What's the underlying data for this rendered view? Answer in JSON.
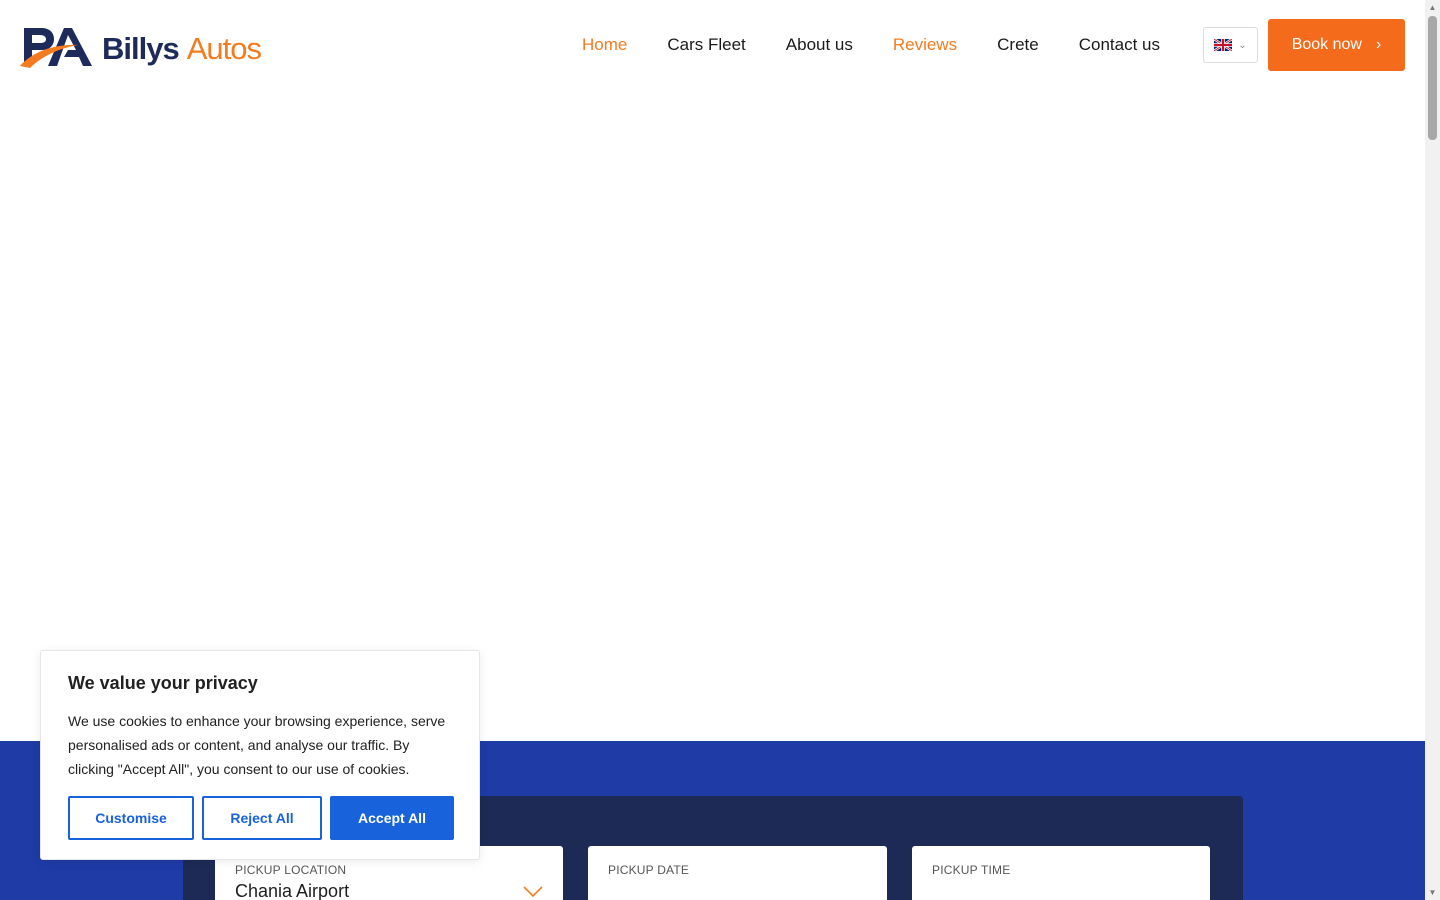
{
  "brand": {
    "name_part1": "Billys",
    "name_part2": "Autos",
    "primary_color": "#1e2a5a",
    "accent_color": "#f47b20"
  },
  "nav": {
    "items": [
      {
        "label": "Home",
        "active": true
      },
      {
        "label": "Cars Fleet",
        "active": false
      },
      {
        "label": "About us",
        "active": false
      },
      {
        "label": "Reviews",
        "active": true
      },
      {
        "label": "Crete",
        "active": false
      },
      {
        "label": "Contact us",
        "active": false
      }
    ]
  },
  "language": {
    "icon": "uk-flag-icon",
    "chevron": "⌄"
  },
  "cta": {
    "label": "Book now",
    "arrow": "›",
    "color": "#f56b1c"
  },
  "booking": {
    "band_color": "#1e3ba6",
    "panel_color": "#1c2a55",
    "pickup_location": {
      "label": "PICKUP LOCATION",
      "value": "Chania Airport"
    },
    "pickup_date": {
      "label": "PICKUP DATE",
      "value": ""
    },
    "pickup_time": {
      "label": "PICKUP TIME",
      "value": ""
    }
  },
  "cookie": {
    "title": "We value your privacy",
    "text": "We use cookies to enhance your browsing experience, serve personalised ads or content, and analyse our traffic. By clicking \"Accept All\", you consent to our use of cookies.",
    "customise_label": "Customise",
    "reject_label": "Reject All",
    "accept_label": "Accept All",
    "button_color": "#1863dc"
  }
}
